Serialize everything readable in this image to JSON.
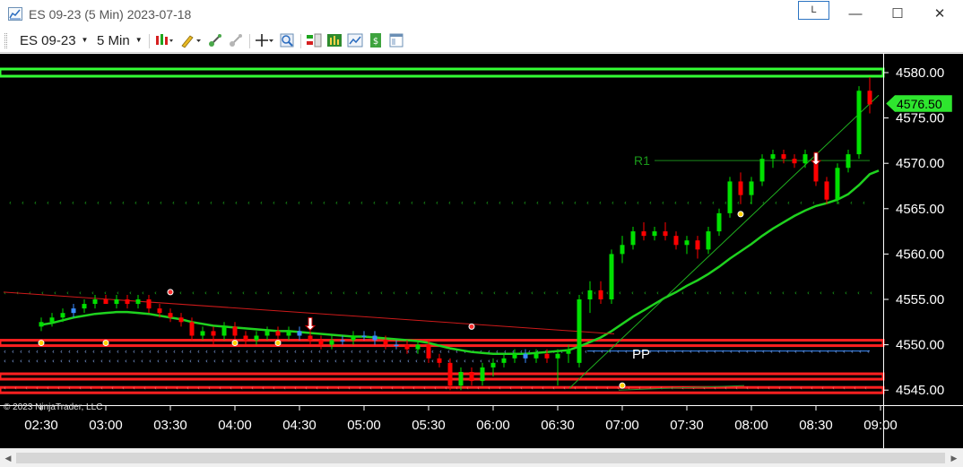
{
  "window": {
    "title": "ES 09-23 (5 Min)  2023-07-18",
    "link_button": "L",
    "minimize": "—",
    "maximize": "☐",
    "close": "✕"
  },
  "toolbar": {
    "instrument": "ES 09-23",
    "interval": "5 Min",
    "icons": [
      "bar-type-icon",
      "drawing-tool-icon",
      "indicators-icon",
      "strategies-icon",
      "crosshair-icon",
      "zoom-icon",
      "chart-trader-icon",
      "strategy-performance-icon",
      "data-box-icon",
      "orders-icon",
      "properties-icon"
    ]
  },
  "chart": {
    "copyright": "© 2023 NinjaTrader, LLC",
    "current_price_label": "4576.50",
    "r1_label": "R1",
    "pp_label": "PP",
    "colors": {
      "background": "#000000",
      "up_candle": "#00e000",
      "down_candle": "#ff0000",
      "neutral_candle": "#3a8cff",
      "moving_average": "#1fd21f",
      "resistance_band": "#33ff33",
      "support_band": "#ff2020"
    }
  },
  "chart_data": {
    "type": "candlestick",
    "y_ticks": [
      "4580.00",
      "4575.00",
      "4570.00",
      "4565.00",
      "4560.00",
      "4555.00",
      "4550.00",
      "4545.00"
    ],
    "x_ticks": [
      "02:30",
      "03:00",
      "03:30",
      "04:00",
      "04:30",
      "05:00",
      "05:30",
      "06:00",
      "06:30",
      "07:00",
      "07:30",
      "08:00",
      "08:30",
      "09:00"
    ],
    "ylim": [
      4543.5,
      4582
    ],
    "levels": {
      "resistance_band": 4580,
      "r1": 4570.3,
      "pivot": 4549.3,
      "support_bands": [
        4550.2,
        4546.5,
        4545
      ]
    },
    "candles": [
      {
        "t": "02:30",
        "o": 4552,
        "h": 4553,
        "l": 4551.5,
        "c": 4552.5
      },
      {
        "t": "02:35",
        "o": 4552.5,
        "h": 4553.5,
        "l": 4552,
        "c": 4553
      },
      {
        "t": "02:40",
        "o": 4553,
        "h": 4554,
        "l": 4552.5,
        "c": 4553.5
      },
      {
        "t": "02:45",
        "o": 4553.5,
        "h": 4554.5,
        "l": 4553,
        "c": 4554
      },
      {
        "t": "02:50",
        "o": 4554,
        "h": 4555,
        "l": 4553.5,
        "c": 4554.5
      },
      {
        "t": "02:55",
        "o": 4554.5,
        "h": 4555.5,
        "l": 4554,
        "c": 4555
      },
      {
        "t": "03:00",
        "o": 4555,
        "h": 4555.5,
        "l": 4554.5,
        "c": 4554.5
      },
      {
        "t": "03:05",
        "o": 4554.5,
        "h": 4555.5,
        "l": 4554,
        "c": 4555
      },
      {
        "t": "03:10",
        "o": 4555,
        "h": 4555.5,
        "l": 4554,
        "c": 4554.5
      },
      {
        "t": "03:15",
        "o": 4554.5,
        "h": 4555.5,
        "l": 4554,
        "c": 4555
      },
      {
        "t": "03:20",
        "o": 4555,
        "h": 4555.5,
        "l": 4553.5,
        "c": 4554
      },
      {
        "t": "03:25",
        "o": 4554,
        "h": 4554.5,
        "l": 4553,
        "c": 4553.5
      },
      {
        "t": "03:30",
        "o": 4553.5,
        "h": 4554,
        "l": 4552.5,
        "c": 4553
      },
      {
        "t": "03:35",
        "o": 4553,
        "h": 4553.5,
        "l": 4552,
        "c": 4552.5
      },
      {
        "t": "03:40",
        "o": 4552.5,
        "h": 4553,
        "l": 4550.5,
        "c": 4551
      },
      {
        "t": "03:45",
        "o": 4551,
        "h": 4552,
        "l": 4550.5,
        "c": 4551.5
      },
      {
        "t": "03:50",
        "o": 4551.5,
        "h": 4552,
        "l": 4550,
        "c": 4551
      },
      {
        "t": "03:55",
        "o": 4551,
        "h": 4552.5,
        "l": 4550.5,
        "c": 4552
      },
      {
        "t": "04:00",
        "o": 4552,
        "h": 4552.5,
        "l": 4550.5,
        "c": 4551
      },
      {
        "t": "04:05",
        "o": 4551,
        "h": 4551.5,
        "l": 4550,
        "c": 4550.5
      },
      {
        "t": "04:10",
        "o": 4550.5,
        "h": 4551.5,
        "l": 4550,
        "c": 4551
      },
      {
        "t": "04:15",
        "o": 4551,
        "h": 4552,
        "l": 4550.5,
        "c": 4551.5
      },
      {
        "t": "04:20",
        "o": 4551.5,
        "h": 4552,
        "l": 4550.5,
        "c": 4551
      },
      {
        "t": "04:25",
        "o": 4551,
        "h": 4552,
        "l": 4550.5,
        "c": 4551.5
      },
      {
        "t": "04:30",
        "o": 4551.5,
        "h": 4552,
        "l": 4550.5,
        "c": 4551
      },
      {
        "t": "04:35",
        "o": 4551,
        "h": 4551.5,
        "l": 4550,
        "c": 4550.5
      },
      {
        "t": "04:40",
        "o": 4550.5,
        "h": 4551,
        "l": 4549.5,
        "c": 4550
      },
      {
        "t": "04:45",
        "o": 4550,
        "h": 4551,
        "l": 4549.5,
        "c": 4550.5
      },
      {
        "t": "04:50",
        "o": 4550.5,
        "h": 4551,
        "l": 4550,
        "c": 4550.5
      },
      {
        "t": "04:55",
        "o": 4550.5,
        "h": 4551.5,
        "l": 4550,
        "c": 4551
      },
      {
        "t": "05:00",
        "o": 4551,
        "h": 4551.5,
        "l": 4550.5,
        "c": 4551
      },
      {
        "t": "05:05",
        "o": 4551,
        "h": 4551.5,
        "l": 4550,
        "c": 4550.5
      },
      {
        "t": "05:10",
        "o": 4550.5,
        "h": 4551,
        "l": 4549.5,
        "c": 4550
      },
      {
        "t": "05:15",
        "o": 4550,
        "h": 4550.5,
        "l": 4549.5,
        "c": 4550
      },
      {
        "t": "05:20",
        "o": 4550,
        "h": 4550.5,
        "l": 4549,
        "c": 4549.5
      },
      {
        "t": "05:25",
        "o": 4549.5,
        "h": 4550.5,
        "l": 4549,
        "c": 4550
      },
      {
        "t": "05:30",
        "o": 4550,
        "h": 4550.5,
        "l": 4548,
        "c": 4548.5
      },
      {
        "t": "05:35",
        "o": 4548.5,
        "h": 4549,
        "l": 4547.5,
        "c": 4548
      },
      {
        "t": "05:40",
        "o": 4548,
        "h": 4548.5,
        "l": 4545,
        "c": 4545.5
      },
      {
        "t": "05:45",
        "o": 4545.5,
        "h": 4547.5,
        "l": 4545,
        "c": 4547
      },
      {
        "t": "05:50",
        "o": 4547,
        "h": 4547.5,
        "l": 4545.5,
        "c": 4546
      },
      {
        "t": "05:55",
        "o": 4546,
        "h": 4548,
        "l": 4545.5,
        "c": 4547.5
      },
      {
        "t": "06:00",
        "o": 4547.5,
        "h": 4548.5,
        "l": 4546.5,
        "c": 4548
      },
      {
        "t": "06:05",
        "o": 4548,
        "h": 4549,
        "l": 4547.5,
        "c": 4548.5
      },
      {
        "t": "06:10",
        "o": 4548.5,
        "h": 4549.5,
        "l": 4548,
        "c": 4549
      },
      {
        "t": "06:15",
        "o": 4549,
        "h": 4549.5,
        "l": 4548,
        "c": 4548.5
      },
      {
        "t": "06:20",
        "o": 4548.5,
        "h": 4549.5,
        "l": 4548,
        "c": 4549
      },
      {
        "t": "06:25",
        "o": 4549,
        "h": 4549.5,
        "l": 4548,
        "c": 4548.5
      },
      {
        "t": "06:30",
        "o": 4548.5,
        "h": 4549.5,
        "l": 4545.5,
        "c": 4549
      },
      {
        "t": "06:35",
        "o": 4549,
        "h": 4550,
        "l": 4548,
        "c": 4549.5
      },
      {
        "t": "06:40",
        "o": 4548,
        "h": 4555.5,
        "l": 4547.5,
        "c": 4555
      },
      {
        "t": "06:45",
        "o": 4555,
        "h": 4557,
        "l": 4553.5,
        "c": 4556
      },
      {
        "t": "06:50",
        "o": 4556,
        "h": 4557,
        "l": 4554.5,
        "c": 4555
      },
      {
        "t": "06:55",
        "o": 4555,
        "h": 4560.5,
        "l": 4554.5,
        "c": 4560
      },
      {
        "t": "07:00",
        "o": 4560,
        "h": 4562,
        "l": 4559,
        "c": 4561
      },
      {
        "t": "07:05",
        "o": 4561,
        "h": 4563,
        "l": 4560.5,
        "c": 4562.5
      },
      {
        "t": "07:10",
        "o": 4562.5,
        "h": 4563.5,
        "l": 4561.5,
        "c": 4562
      },
      {
        "t": "07:15",
        "o": 4562,
        "h": 4563,
        "l": 4561.5,
        "c": 4562.5
      },
      {
        "t": "07:20",
        "o": 4562.5,
        "h": 4563.5,
        "l": 4561.5,
        "c": 4562
      },
      {
        "t": "07:25",
        "o": 4562,
        "h": 4562.5,
        "l": 4560.5,
        "c": 4561
      },
      {
        "t": "07:30",
        "o": 4561,
        "h": 4562,
        "l": 4560,
        "c": 4561.5
      },
      {
        "t": "07:35",
        "o": 4561.5,
        "h": 4562,
        "l": 4559.5,
        "c": 4560.5
      },
      {
        "t": "07:40",
        "o": 4560.5,
        "h": 4563,
        "l": 4560,
        "c": 4562.5
      },
      {
        "t": "07:45",
        "o": 4562.5,
        "h": 4565,
        "l": 4562,
        "c": 4564.5
      },
      {
        "t": "07:50",
        "o": 4564.5,
        "h": 4568.5,
        "l": 4564,
        "c": 4568
      },
      {
        "t": "07:55",
        "o": 4568,
        "h": 4569,
        "l": 4565.5,
        "c": 4566.5
      },
      {
        "t": "08:00",
        "o": 4566.5,
        "h": 4568.5,
        "l": 4565.5,
        "c": 4568
      },
      {
        "t": "08:05",
        "o": 4568,
        "h": 4571,
        "l": 4567.5,
        "c": 4570.5
      },
      {
        "t": "08:10",
        "o": 4570.5,
        "h": 4571.5,
        "l": 4569.5,
        "c": 4571
      },
      {
        "t": "08:15",
        "o": 4571,
        "h": 4571.5,
        "l": 4570,
        "c": 4570.5
      },
      {
        "t": "08:20",
        "o": 4570.5,
        "h": 4571,
        "l": 4569.5,
        "c": 4570
      },
      {
        "t": "08:25",
        "o": 4570,
        "h": 4571.5,
        "l": 4569.5,
        "c": 4571
      },
      {
        "t": "08:30",
        "o": 4570.5,
        "h": 4571,
        "l": 4567.5,
        "c": 4568
      },
      {
        "t": "08:35",
        "o": 4568,
        "h": 4568.5,
        "l": 4565.5,
        "c": 4566
      },
      {
        "t": "08:40",
        "o": 4566,
        "h": 4570,
        "l": 4565.5,
        "c": 4569.5
      },
      {
        "t": "08:45",
        "o": 4569.5,
        "h": 4571.5,
        "l": 4569,
        "c": 4571
      },
      {
        "t": "08:50",
        "o": 4571,
        "h": 4578.5,
        "l": 4570.5,
        "c": 4578
      },
      {
        "t": "08:55",
        "o": 4578,
        "h": 4579.5,
        "l": 4575.5,
        "c": 4576.5
      }
    ],
    "moving_average": [
      4552.2,
      4552.4,
      4552.7,
      4553,
      4553.2,
      4553.4,
      4553.5,
      4553.6,
      4553.6,
      4553.5,
      4553.4,
      4553.2,
      4553,
      4552.8,
      4552.5,
      4552.3,
      4552.1,
      4552,
      4551.9,
      4551.8,
      4551.7,
      4551.6,
      4551.5,
      4551.5,
      4551.4,
      4551.3,
      4551.2,
      4551.1,
      4551,
      4550.9,
      4550.9,
      4550.8,
      4550.7,
      4550.6,
      4550.5,
      4550.4,
      4550.2,
      4549.9,
      4549.6,
      4549.4,
      4549.2,
      4549.1,
      4549,
      4549,
      4549,
      4549,
      4549.1,
      4549.2,
      4549.3,
      4549.4,
      4549.8,
      4550.3,
      4550.8,
      4551.5,
      4552.3,
      4553.1,
      4553.8,
      4554.5,
      4555.2,
      4555.8,
      4556.5,
      4557.1,
      4557.8,
      4558.6,
      4559.5,
      4560.3,
      4561.1,
      4562,
      4562.8,
      4563.5,
      4564.2,
      4564.8,
      4565.3,
      4565.6,
      4566,
      4566.6,
      4567.6,
      4568.8
    ]
  }
}
